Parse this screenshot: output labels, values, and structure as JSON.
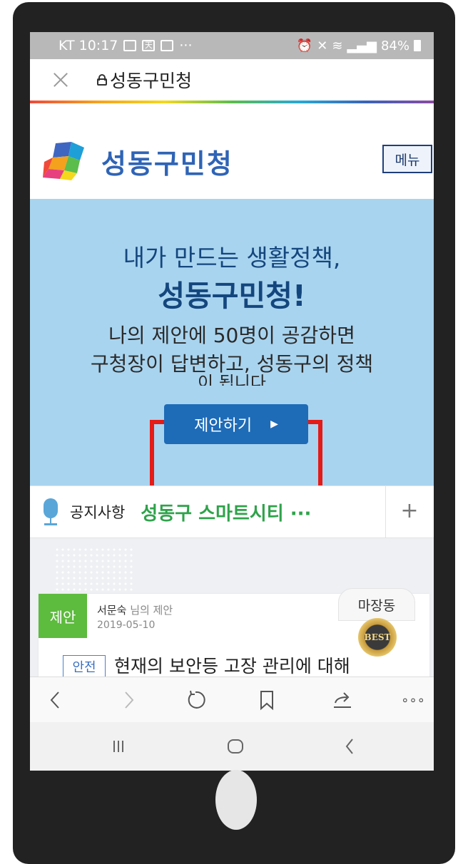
{
  "status_bar": {
    "carrier_time": "KT 10:17",
    "more": "···",
    "battery": "84%"
  },
  "browser": {
    "page_title": "성동구민청"
  },
  "site": {
    "logo_text": "성동구민청",
    "menu_label": "메뉴"
  },
  "hero": {
    "line1": "내가 만드는 생활정책,",
    "line2": "성동구민청!",
    "sub_line1": "나의 제안에 50명이 공감하면",
    "sub_line2": "구청장이 답변하고, 성동구의 정책",
    "sub_line3": "이 됩니다",
    "button_label": "제안하기",
    "button_arrow": "▶"
  },
  "notice": {
    "label": "공지사항",
    "text": "성동구 스마트시티 ···",
    "more_label": "+"
  },
  "card": {
    "tag": "제안",
    "author": "서문숙",
    "author_suffix": "님의 제안",
    "date": "2019-05-10",
    "dong": "마장동",
    "badge": "BEST",
    "category": "안전",
    "title": "현재의 보안등 고장 관리에 대해"
  },
  "toolbar": {
    "more": "∘∘∘"
  },
  "colors": {
    "hero_bg": "#a9d4ef",
    "primary_blue": "#1e6bb8",
    "highlight_red": "#e41b17",
    "notice_green": "#2ea34a",
    "tag_green": "#5dbb3d"
  },
  "icons": [
    "close-icon",
    "lock-icon",
    "microphone-icon",
    "best-medal-icon",
    "back-icon",
    "forward-icon",
    "reload-icon",
    "bookmark-icon",
    "share-icon",
    "more-icon",
    "recent-apps-icon",
    "home-icon",
    "android-back-icon"
  ]
}
